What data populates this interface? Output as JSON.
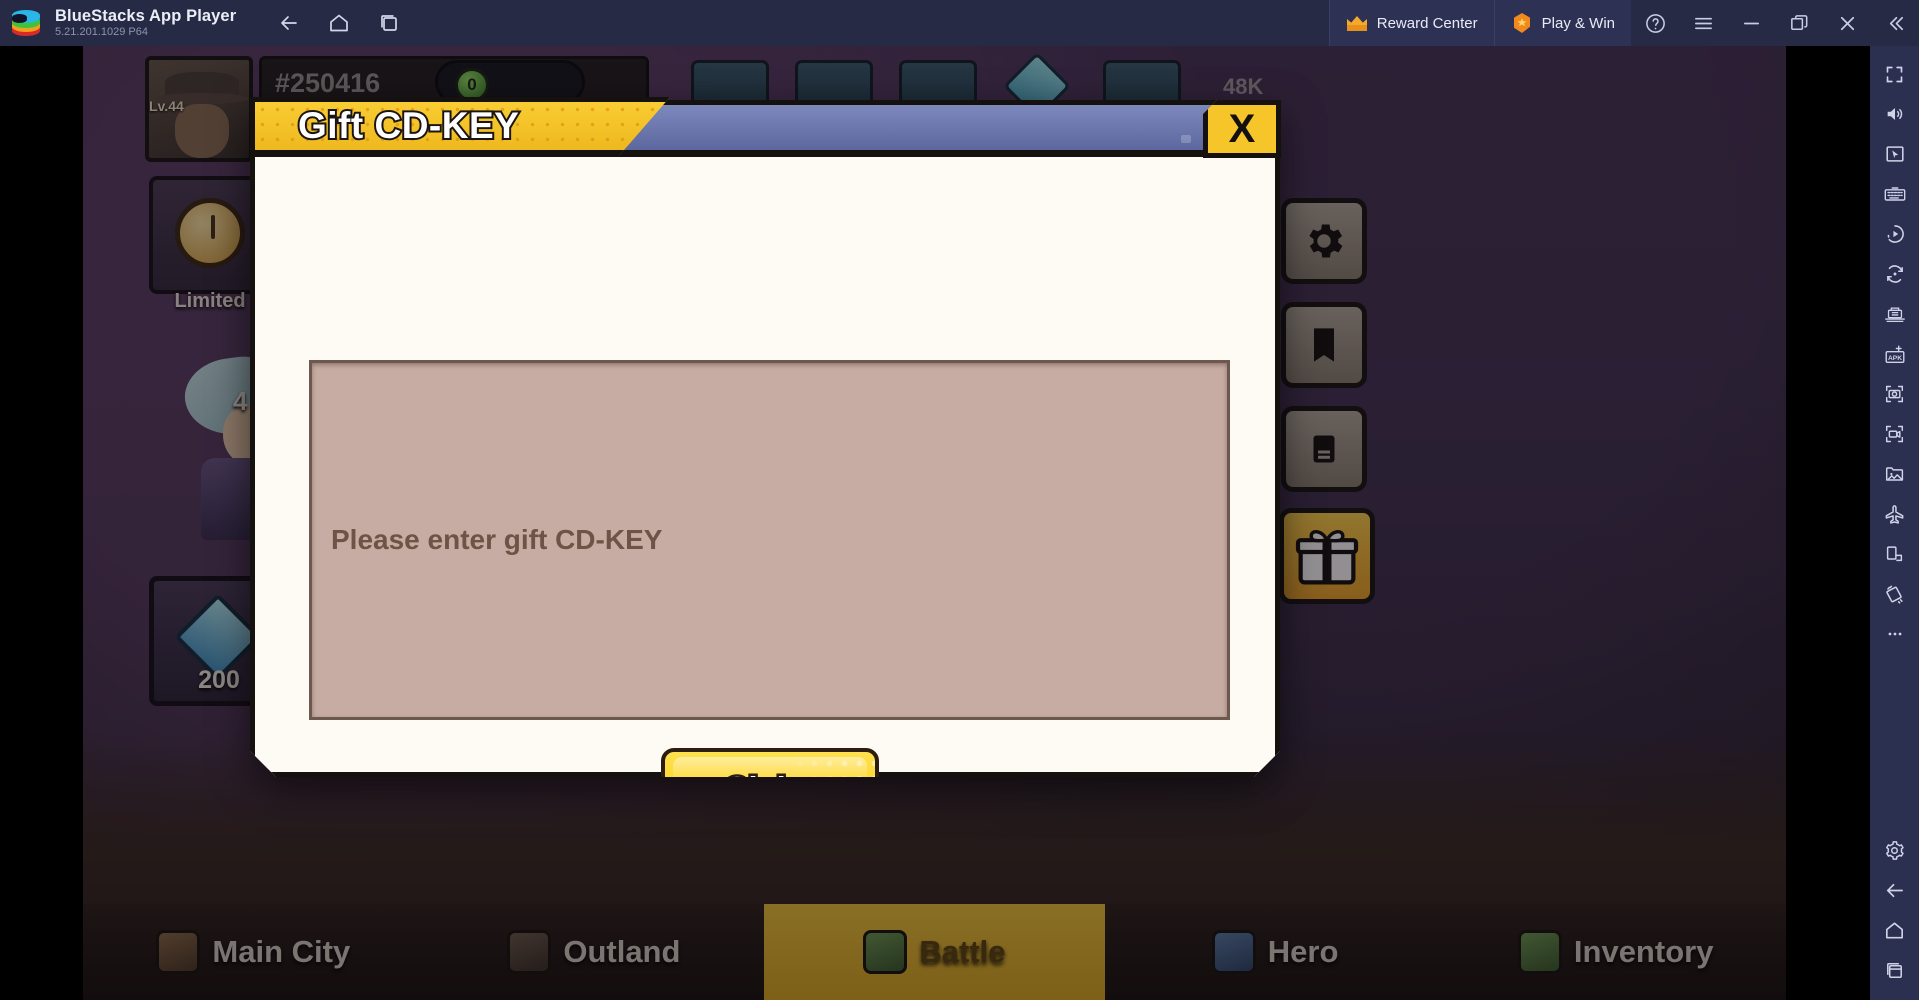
{
  "titlebar": {
    "app_name": "BlueStacks App Player",
    "version": "5.21.201.1029  P64",
    "logo_icon": "bluestacks-logo-icon",
    "nav": [
      {
        "name": "back",
        "icon": "arrow-left-icon"
      },
      {
        "name": "home",
        "icon": "home-icon"
      },
      {
        "name": "recents",
        "icon": "recent-apps-icon"
      }
    ],
    "promos": [
      {
        "label": "Reward Center",
        "icon": "crown-icon"
      },
      {
        "label": "Play & Win",
        "icon": "hex-star-icon"
      }
    ],
    "window_controls": [
      {
        "name": "help",
        "icon": "help-circle-icon"
      },
      {
        "name": "menu",
        "icon": "hamburger-menu-icon"
      },
      {
        "name": "minimize",
        "icon": "minimize-icon"
      },
      {
        "name": "maximize",
        "icon": "restore-window-icon"
      },
      {
        "name": "close",
        "icon": "close-x-icon"
      },
      {
        "name": "collapse-sidebar",
        "icon": "chevron-double-left-icon"
      }
    ]
  },
  "game": {
    "hud": {
      "player_id": "#250416",
      "coin_value": "0",
      "hero_level": "4",
      "top_level": "48K",
      "limited_label": "Limited",
      "gem_count": "200",
      "portrait_level": "Lv.44"
    },
    "bottom_nav": [
      {
        "label": "Main City",
        "active": false,
        "icon": "city-icon"
      },
      {
        "label": "Outland",
        "active": false,
        "icon": "outland-icon"
      },
      {
        "label": "Battle",
        "active": true,
        "icon": "battle-icon"
      },
      {
        "label": "Hero",
        "active": false,
        "icon": "hero-icon"
      },
      {
        "label": "Inventory",
        "active": false,
        "icon": "inventory-icon"
      }
    ],
    "side_buttons": [
      {
        "name": "settings",
        "icon": "gear-icon"
      },
      {
        "name": "quests",
        "icon": "book-icon"
      },
      {
        "name": "mail",
        "icon": "mail-icon"
      },
      {
        "name": "gift",
        "icon": "gift-box-icon"
      }
    ]
  },
  "modal": {
    "title": "Gift CD-KEY",
    "close_label": "X",
    "input": {
      "placeholder": "Please enter gift CD-KEY",
      "value": ""
    },
    "claim_label": "Claim"
  },
  "sidebar": {
    "items": [
      {
        "name": "fullscreen",
        "icon": "fullscreen-icon"
      },
      {
        "name": "volume",
        "icon": "speaker-volume-icon"
      },
      {
        "name": "game-controls",
        "icon": "cursor-pointer-icon"
      },
      {
        "name": "keyboard-controls",
        "icon": "keyboard-icon"
      },
      {
        "name": "macro-recorder",
        "icon": "macro-play-icon"
      },
      {
        "name": "sync-operations",
        "icon": "sync-rotate-icon"
      },
      {
        "name": "multi-instance",
        "icon": "multi-instance-icon"
      },
      {
        "name": "install-apk",
        "icon": "apk-install-icon"
      },
      {
        "name": "screenshot",
        "icon": "camera-icon"
      },
      {
        "name": "record-screen",
        "icon": "video-camera-icon"
      },
      {
        "name": "media-manager",
        "icon": "media-gallery-icon"
      },
      {
        "name": "eco-mode",
        "icon": "airplane-icon"
      },
      {
        "name": "device-profile",
        "icon": "device-phone-icon"
      },
      {
        "name": "tilt-control",
        "icon": "tilt-device-icon"
      },
      {
        "name": "more-options",
        "icon": "ellipsis-icon"
      }
    ],
    "bottom_items": [
      {
        "name": "settings",
        "icon": "gear-icon"
      },
      {
        "name": "back",
        "icon": "arrow-left-icon"
      },
      {
        "name": "home",
        "icon": "home-icon"
      },
      {
        "name": "recent-apps",
        "icon": "recent-apps-icon"
      }
    ]
  },
  "colors": {
    "titlebar_bg": "#262a45",
    "sidebar_bg": "#2b2f50",
    "accent_yellow": "#f6c52a",
    "modal_body": "#fdfbf4",
    "input_bg": "#c7aca3",
    "input_text": "#6d5446"
  }
}
